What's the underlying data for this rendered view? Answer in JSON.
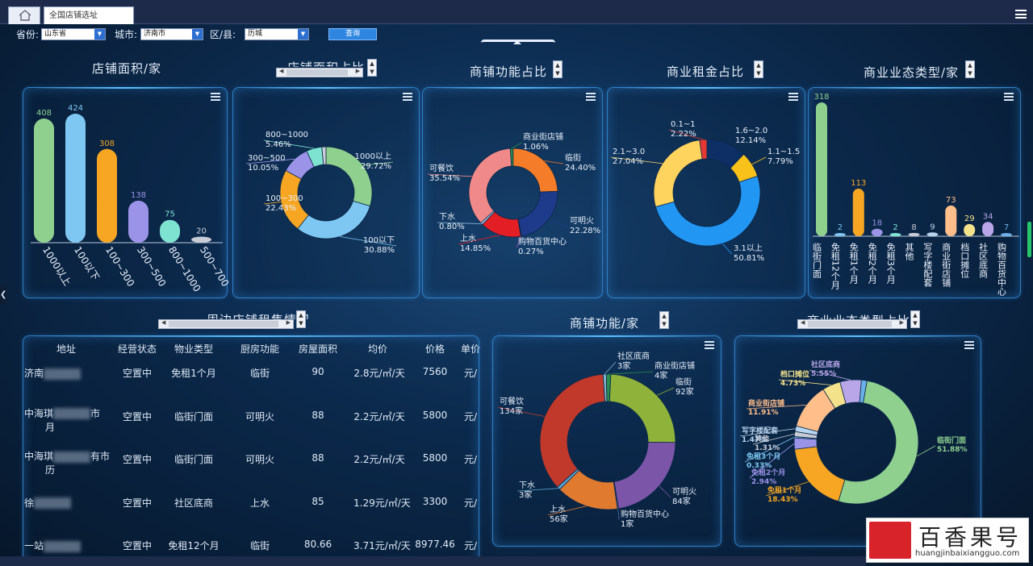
{
  "tab": {
    "title": "全国店铺选址"
  },
  "filters": {
    "province_label": "省份:",
    "province": "山东省",
    "city_label": "城市:",
    "city": "济南市",
    "district_label": "区/县:",
    "district": "历城",
    "query": "查询"
  },
  "titles": {
    "area_count": "店铺面积/家",
    "area_share": "店铺面积占比",
    "func_share": "商铺功能占比",
    "rent_share": "商业租金占比",
    "biz_count": "商业业态类型/家",
    "rent_list": "周边店铺租售情况",
    "func_count": "商铺功能/家",
    "biz_share": "商业业态类型占比"
  },
  "table": {
    "headers": [
      "地址",
      "经营状态",
      "物业类型",
      "厨房功能",
      "房屋面积",
      "均价",
      "价格",
      "单价"
    ],
    "rows": [
      {
        "addr": "济南",
        "status": "空置中",
        "type": "免租1个月",
        "kitchen": "临街",
        "area": "90",
        "avg": "2.8元/㎡/天",
        "price": "7560",
        "unit": "元/"
      },
      {
        "addr": "中海琪",
        "addr2": "市",
        "addr3": "月",
        "status": "空置中",
        "type": "临街门面",
        "kitchen": "可明火",
        "area": "88",
        "avg": "2.2元/㎡/天",
        "price": "5800",
        "unit": "元/"
      },
      {
        "addr": "中海琪",
        "addr2": "有市",
        "addr3": "历",
        "status": "空置中",
        "type": "临街门面",
        "kitchen": "可明火",
        "area": "88",
        "avg": "2.2元/㎡/天",
        "price": "5800",
        "unit": "元/"
      },
      {
        "addr": "徐",
        "status": "空置中",
        "type": "社区底商",
        "kitchen": "上水",
        "area": "85",
        "avg": "1.29元/㎡/天",
        "price": "3300",
        "unit": "元/"
      },
      {
        "addr": "一站",
        "status": "空置中",
        "type": "免租12个月",
        "kitchen": "临街",
        "area": "80.66",
        "avg": "3.71元/㎡/天",
        "price": "8977.46",
        "unit": "元/"
      }
    ]
  },
  "watermark": {
    "cn": "百香果号",
    "url": "huangjinbaixiangguo.com"
  },
  "chart_data": [
    {
      "id": "area_bar",
      "type": "bar",
      "title": "店铺面积/家",
      "categories": [
        "1000以上",
        "100以下",
        "100~300",
        "300~500",
        "800~1000",
        "500~700"
      ],
      "values": [
        408,
        424,
        308,
        138,
        75,
        20
      ],
      "colors": [
        "#8fd08f",
        "#7ec7f2",
        "#f6a623",
        "#9b93e8",
        "#7fe3d2",
        "#c8ccd6"
      ]
    },
    {
      "id": "area_pie",
      "type": "pie",
      "title": "店铺面积占比",
      "slices": [
        {
          "name": "1000以上",
          "label": "29.72%",
          "value": 29.72,
          "color": "#8fd08f"
        },
        {
          "name": "100以下",
          "label": "30.88%",
          "value": 30.88,
          "color": "#7ec7f2"
        },
        {
          "name": "100~300",
          "label": "22.43%",
          "value": 22.43,
          "color": "#f6a623"
        },
        {
          "name": "300~500",
          "label": "10.05%",
          "value": 10.05,
          "color": "#9b93e8"
        },
        {
          "name": "800~1000",
          "label": "5.46%",
          "value": 5.46,
          "color": "#7fe3d2"
        },
        {
          "name": "",
          "label": "",
          "value": 1.46,
          "color": "#c8ccd6"
        }
      ]
    },
    {
      "id": "func_pie",
      "type": "pie",
      "title": "商铺功能占比",
      "slices": [
        {
          "name": "商业街店铺",
          "label": "1.06%",
          "value": 1.06,
          "color": "#2b8c4d"
        },
        {
          "name": "临街",
          "label": "24.40%",
          "value": 24.4,
          "color": "#f57c28"
        },
        {
          "name": "可明火",
          "label": "22.28%",
          "value": 22.28,
          "color": "#1e3a8a"
        },
        {
          "name": "购物百货中心",
          "label": "0.27%",
          "value": 0.27,
          "color": "#9b4fb5"
        },
        {
          "name": "上水",
          "label": "14.85%",
          "value": 14.85,
          "color": "#e31e24"
        },
        {
          "name": "下水",
          "label": "0.80%",
          "value": 0.8,
          "color": "#9cc8e8"
        },
        {
          "name": "可餐饮",
          "label": "35.54%",
          "value": 35.54,
          "color": "#f08a8a"
        }
      ]
    },
    {
      "id": "rent_pie",
      "type": "pie",
      "title": "商业租金占比",
      "slices": [
        {
          "name": "1.6~2.0",
          "label": "12.14%",
          "value": 12.14,
          "color": "#0e2f66"
        },
        {
          "name": "1.1~1.5",
          "label": "7.79%",
          "value": 7.79,
          "color": "#f8c21a"
        },
        {
          "name": "3.1以上",
          "label": "50.81%",
          "value": 50.81,
          "color": "#2196f3"
        },
        {
          "name": "2.1~3.0",
          "label": "27.04%",
          "value": 27.04,
          "color": "#ffd45e"
        },
        {
          "name": "0.1~1",
          "label": "2.22%",
          "value": 2.22,
          "color": "#e53935"
        }
      ]
    },
    {
      "id": "biz_bar",
      "type": "bar",
      "title": "商业业态类型/家",
      "categories": [
        "临街门面",
        "免租12个月",
        "免租1个月",
        "免租2个月",
        "免租3个月",
        "其他",
        "写字楼配套",
        "商业街店铺",
        "档口摊位",
        "社区底商",
        "购物百货中心"
      ],
      "values": [
        318,
        2,
        113,
        18,
        2,
        8,
        9,
        73,
        29,
        34,
        7
      ],
      "colors": [
        "#8fd08f",
        "#7ec7f2",
        "#f6a623",
        "#9b93e8",
        "#7fe3d2",
        "#c8ccd6",
        "#b9d6f0",
        "#ffbe8a",
        "#f3e28a",
        "#b8a6e8",
        "#6ab0e8"
      ]
    },
    {
      "id": "func_count_pie",
      "type": "pie",
      "title": "商铺功能/家",
      "slices": [
        {
          "name": "社区底商",
          "label": "3家",
          "value": 3,
          "color": "#7fb0c8"
        },
        {
          "name": "商业街店铺",
          "label": "4家",
          "value": 4,
          "color": "#2b8c4d"
        },
        {
          "name": "临街",
          "label": "92家",
          "value": 92,
          "color": "#8fb23a"
        },
        {
          "name": "可明火",
          "label": "84家",
          "value": 84,
          "color": "#7b56a8"
        },
        {
          "name": "购物百货中心",
          "label": "1家",
          "value": 1,
          "color": "#4a6fa8"
        },
        {
          "name": "上水",
          "label": "56家",
          "value": 56,
          "color": "#e07a2e"
        },
        {
          "name": "下水",
          "label": "3家",
          "value": 3,
          "color": "#5aa0d0"
        },
        {
          "name": "可餐饮",
          "label": "134家",
          "value": 134,
          "color": "#c0392b"
        }
      ]
    },
    {
      "id": "biz_pie",
      "type": "pie",
      "title": "商业业态类型占比",
      "slices": [
        {
          "name": "临街门面",
          "label": "51.88%",
          "value": 51.88,
          "color": "#8fd08f"
        },
        {
          "name": "免租1个月",
          "label": "18.43%",
          "value": 18.43,
          "color": "#f6a623"
        },
        {
          "name": "免租2个月",
          "label": "2.94%",
          "value": 2.94,
          "color": "#9b93e8"
        },
        {
          "name": "免租3个月",
          "label": "0.33%",
          "value": 0.33,
          "color": "#7ec7f2"
        },
        {
          "name": "其他",
          "label": "1.31%",
          "value": 1.31,
          "color": "#c8ccd6"
        },
        {
          "name": "写字楼配套",
          "label": "1.47%",
          "value": 1.47,
          "color": "#b9d6f0"
        },
        {
          "name": "商业街店铺",
          "label": "11.91%",
          "value": 11.91,
          "color": "#ffbe8a"
        },
        {
          "name": "档口摊位",
          "label": "4.73%",
          "value": 4.73,
          "color": "#f3e28a"
        },
        {
          "name": "社区底商",
          "label": "5.55%",
          "value": 5.55,
          "color": "#b8a6e8"
        },
        {
          "name": "",
          "label": "",
          "value": 1.45,
          "color": "#6ab0e8"
        }
      ]
    }
  ]
}
